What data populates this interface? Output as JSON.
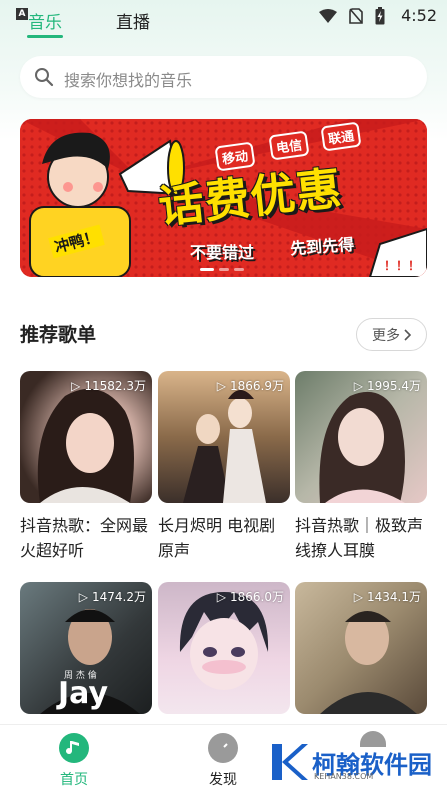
{
  "status": {
    "time": "4:52",
    "a_badge": "A"
  },
  "tabs": {
    "music": "音乐",
    "live": "直播"
  },
  "search": {
    "placeholder": "搜索你想找的音乐"
  },
  "banner": {
    "headline": "话费优惠",
    "tags": [
      "移动",
      "电信",
      "联通"
    ],
    "sub_left": "不要错过",
    "sub_right": "先到先得",
    "mascot_text": "冲鸭！",
    "exclaim": "！！！"
  },
  "section": {
    "title": "推荐歌单",
    "more": "更多"
  },
  "playlists": [
    {
      "count": "11582.3万",
      "title": "抖音热歌：全网最火超好听"
    },
    {
      "count": "1866.9万",
      "title": "长月烬明 电视剧原声"
    },
    {
      "count": "1995.4万",
      "title": "抖音热歌｜极致声线撩人耳膜"
    },
    {
      "count": "1474.2万",
      "title": ""
    },
    {
      "count": "1866.0万",
      "title": ""
    },
    {
      "count": "1434.1万",
      "title": ""
    }
  ],
  "cover_text": {
    "jay": "Jay",
    "jay_cn": "周 杰 倫"
  },
  "bottom_nav": {
    "home": "首页",
    "discover": "发现"
  },
  "watermark": {
    "name": "柯翰软件园",
    "url": "KEHAN38.COM"
  },
  "colors": {
    "accent": "#23b77c",
    "banner_red": "#e02a22",
    "banner_yellow": "#ffe000"
  }
}
